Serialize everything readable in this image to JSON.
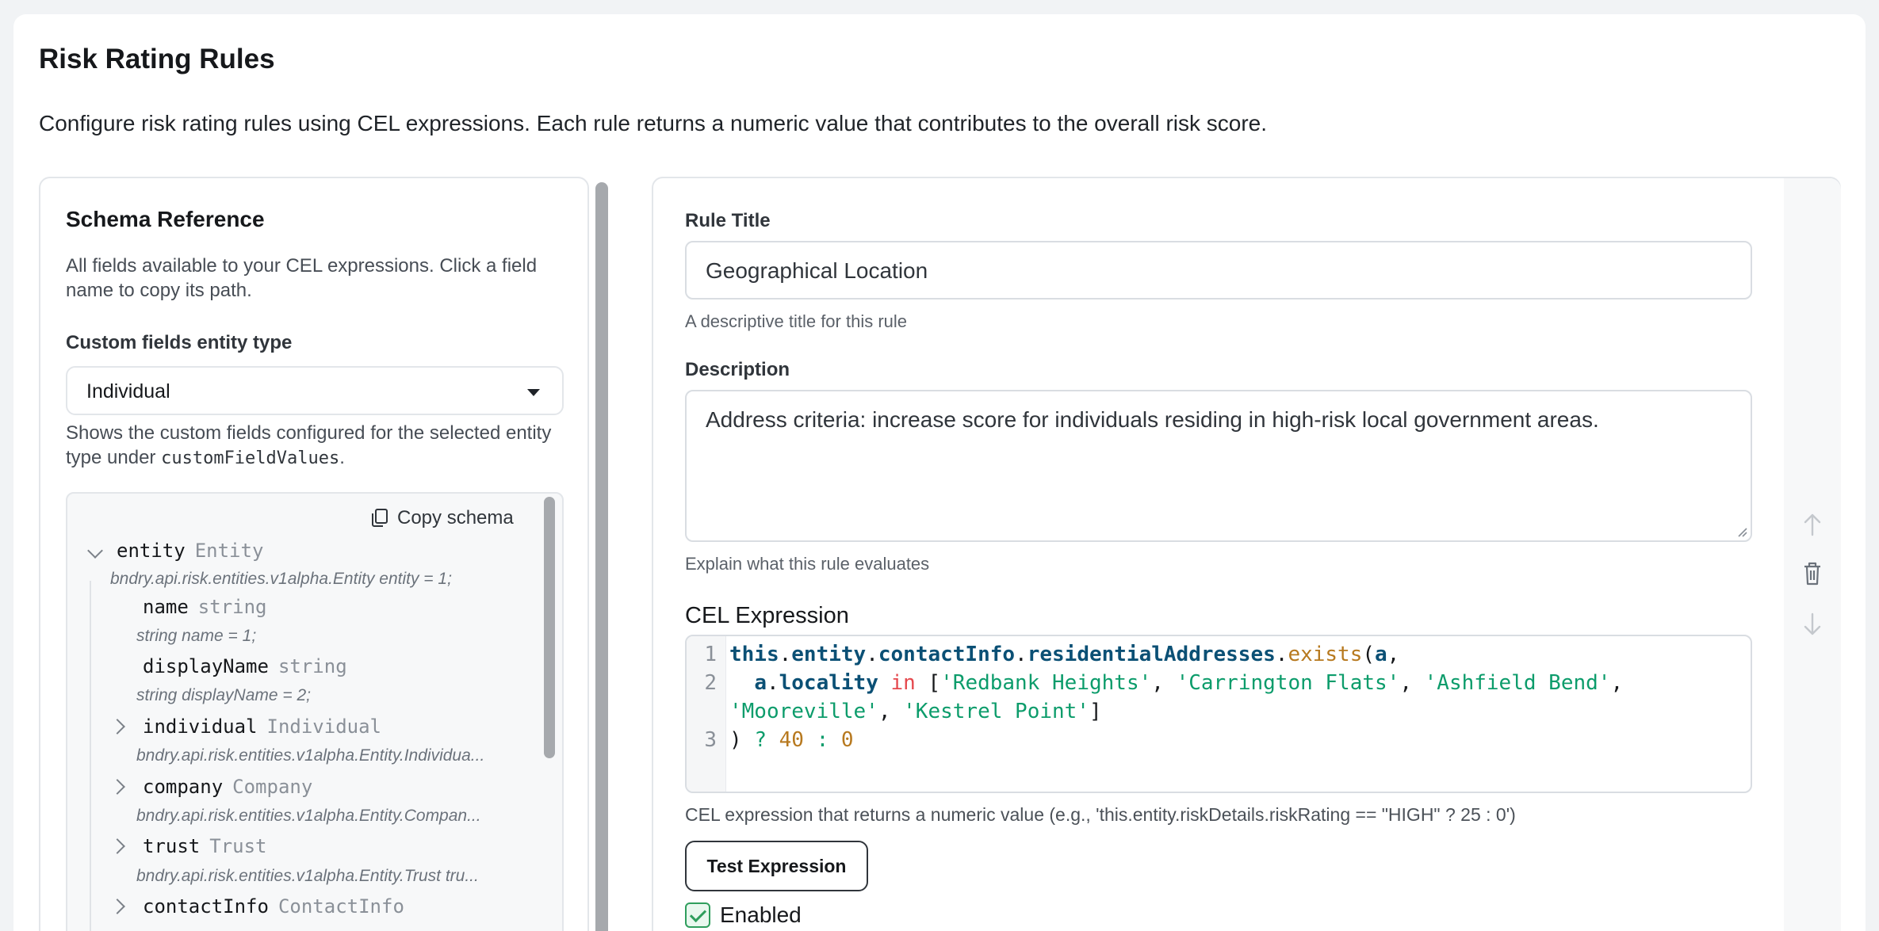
{
  "page": {
    "title": "Risk Rating Rules",
    "description": "Configure risk rating rules using CEL expressions. Each rule returns a numeric value that contributes to the overall risk score."
  },
  "schema": {
    "title": "Schema Reference",
    "description": "All fields available to your CEL expressions. Click a field name to copy its path.",
    "entity_type_label": "Custom fields entity type",
    "entity_type_value": "Individual",
    "hint_prefix": "Shows the custom fields configured for the selected entity type under ",
    "hint_code": "customFieldValues",
    "hint_suffix": ".",
    "copy_label": "Copy schema",
    "tree": [
      {
        "name": "entity",
        "type": "Entity",
        "proto": "bndry.api.risk.entities.v1alpha.Entity entity = 1;",
        "expanded": true
      },
      {
        "name": "name",
        "type": "string",
        "proto": "string name = 1;"
      },
      {
        "name": "displayName",
        "type": "string",
        "proto": "string displayName = 2;"
      },
      {
        "name": "individual",
        "type": "Individual",
        "proto": "bndry.api.risk.entities.v1alpha.Entity.Individua...",
        "expanded": false
      },
      {
        "name": "company",
        "type": "Company",
        "proto": "bndry.api.risk.entities.v1alpha.Entity.Compan...",
        "expanded": false
      },
      {
        "name": "trust",
        "type": "Trust",
        "proto": "bndry.api.risk.entities.v1alpha.Entity.Trust tru...",
        "expanded": false
      },
      {
        "name": "contactInfo",
        "type": "ContactInfo",
        "proto": "",
        "expanded": false
      }
    ]
  },
  "rule": {
    "title_label": "Rule Title",
    "title_value": "Geographical Location",
    "title_help": "A descriptive title for this rule",
    "description_label": "Description",
    "description_value": "Address criteria: increase score for individuals residing in high-risk local government areas.",
    "description_help": "Explain what this rule evaluates",
    "cel_label": "CEL Expression",
    "cel_line_numbers": [
      "1",
      "2",
      "3"
    ],
    "cel_tokens": {
      "this": "this",
      "entity": "entity",
      "contactInfo": "contactInfo",
      "residentialAddresses": "residentialAddresses",
      "exists": "exists",
      "a": "a",
      "locality": "locality",
      "in": "in",
      "s1": "'Redbank Heights'",
      "s2": "'Carrington Flats'",
      "s3": "'Ashfield Bend'",
      "s4": "'Mooreville'",
      "s5": "'Kestrel Point'",
      "q": "?",
      "n40": "40",
      "colon": ":",
      "n0": "0"
    },
    "cel_help": "CEL expression that returns a numeric value (e.g., 'this.entity.riskDetails.riskRating == \"HIGH\" ? 25 : 0')",
    "test_label": "Test Expression",
    "enabled_label": "Enabled",
    "enabled": true
  },
  "icons": {
    "copy": "copy-icon",
    "move_up": "arrow-up-icon",
    "delete": "trash-icon",
    "move_down": "arrow-down-icon",
    "dropdown": "caret-down-icon"
  },
  "colors": {
    "accent_green": "#2f9e5d",
    "code_keyword": "#0b5075",
    "code_string": "#0c9c6b",
    "code_function": "#b7791f",
    "code_operator": "#e5484d"
  }
}
